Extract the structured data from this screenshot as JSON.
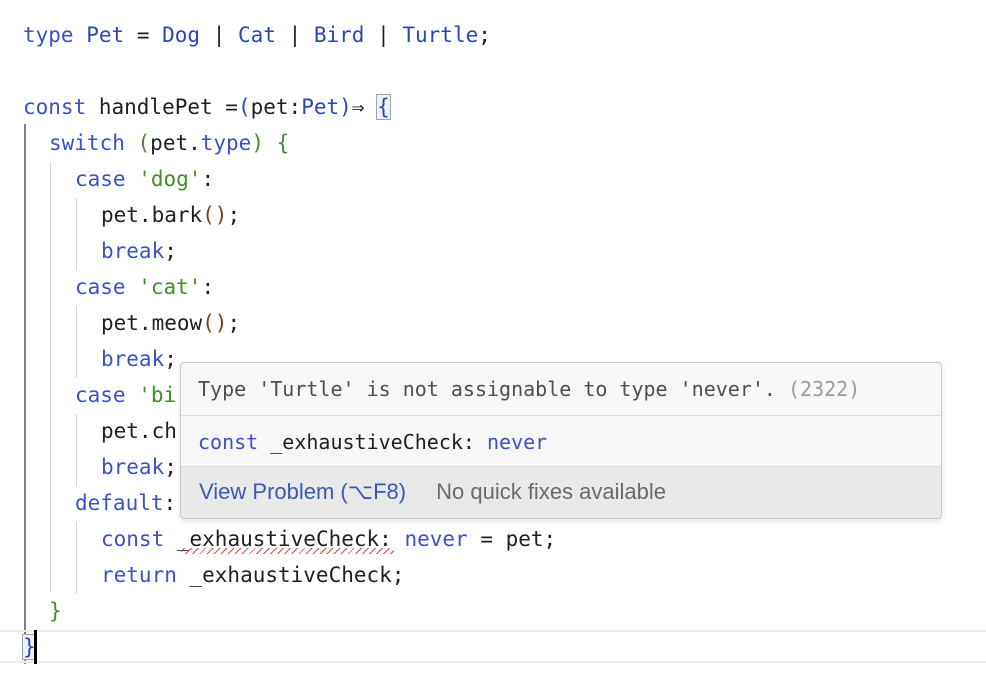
{
  "code": {
    "line1": {
      "kw_type": "type",
      "name": "Pet",
      "eq": " = ",
      "t1": "Dog",
      "sep1": " | ",
      "t2": "Cat",
      "sep2": " | ",
      "t3": "Bird",
      "sep3": " | ",
      "t4": "Turtle",
      "semi": ";"
    },
    "line3": {
      "kw_const": "const",
      "fn": " handlePet =",
      "paren_open": "(",
      "param": "pet",
      "colon": ":",
      "ptype": "Pet",
      "paren_close": ")",
      "arrow": "⇒ ",
      "brace": "{"
    },
    "line4": {
      "kw": "switch",
      "space": " ",
      "open": "(",
      "obj": "pet.",
      "prop": "type",
      "close": ")",
      "brace": " {"
    },
    "case_dog": {
      "kw": "case",
      "val": "'dog'",
      "colon": ":"
    },
    "bark": {
      "call": "pet.bark",
      "parens": "()",
      "semi": ";"
    },
    "break": {
      "kw": "break",
      "semi": ";"
    },
    "case_cat": {
      "kw": "case",
      "val": "'cat'",
      "colon": ":"
    },
    "meow": {
      "call": "pet.meow",
      "parens": "()",
      "semi": ";"
    },
    "case_bird": {
      "kw": "case",
      "val": "'bi"
    },
    "chirp": {
      "call": "pet.ch"
    },
    "default": {
      "kw": "default",
      "colon": ":"
    },
    "exhaustive": {
      "kw": "const",
      "name": "_exhaustiveCheck",
      "colon": ": ",
      "type": "never",
      "rest": " = pet;"
    },
    "ret": {
      "kw": "return",
      "rest": " _exhaustiveCheck;"
    },
    "close_switch": "}",
    "close_fn": "}"
  },
  "popup": {
    "message": "Type 'Turtle' is not assignable to type 'never'.",
    "code": " (2322)",
    "sig_kw": "const",
    "sig_name": " _exhaustiveCheck: ",
    "sig_type": "never",
    "action_link": "View Problem (⌥F8)",
    "action_none": "No quick fixes available"
  },
  "colors": {
    "keyword": "#3b51c6",
    "string": "#3f8f2a",
    "error": "#d23b3b",
    "link": "#3a5bb3"
  }
}
